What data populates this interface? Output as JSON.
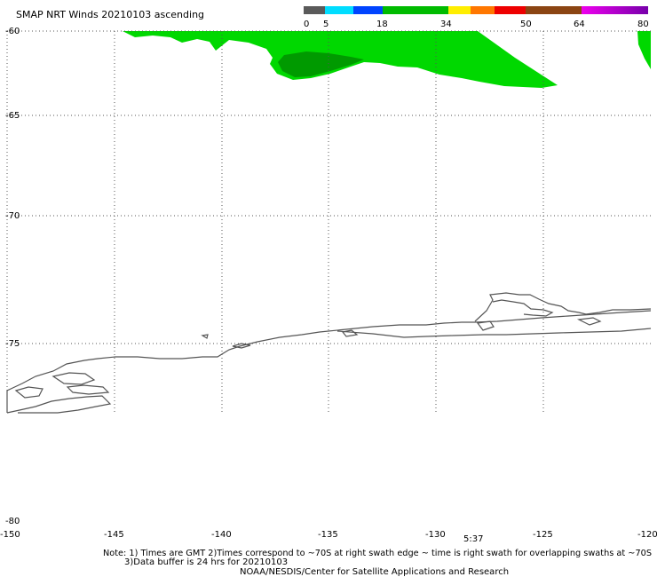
{
  "title": "SMAP NRT Winds 20210103 ascending",
  "colorbar": {
    "tick_labels": [
      "0",
      "5",
      "18",
      "34",
      "50",
      "64",
      "80"
    ],
    "colors": {
      "gray": "#5a5a5a",
      "cyan": "#00ddff",
      "blue": "#0044ff",
      "green": "#00bb00",
      "yellow": "#ffee00",
      "orange": "#ff7700",
      "red": "#ee0000",
      "brown": "#8b4513",
      "magenta": "#ee00ee",
      "purple": "#7700aa"
    }
  },
  "axes": {
    "lat_labels": [
      "-60",
      "-65",
      "-70",
      "-75",
      "-80"
    ],
    "lon_labels": [
      "-150",
      "-145",
      "-140",
      "-135",
      "-130",
      "-125",
      "-120"
    ]
  },
  "time_label": "5:37",
  "notes": {
    "line1": "Note: 1) Times are GMT 2)Times correspond to ~70S at right swath edge ~ time is right swath for overlapping swaths at ~70S",
    "line2": "3)Data buffer is 24 hrs for 20210103",
    "credit": "NOAA/NESDIS/Center for Satellite Applications and Research"
  },
  "swath_colors": {
    "main": "#00d800",
    "dark": "#009a00"
  }
}
